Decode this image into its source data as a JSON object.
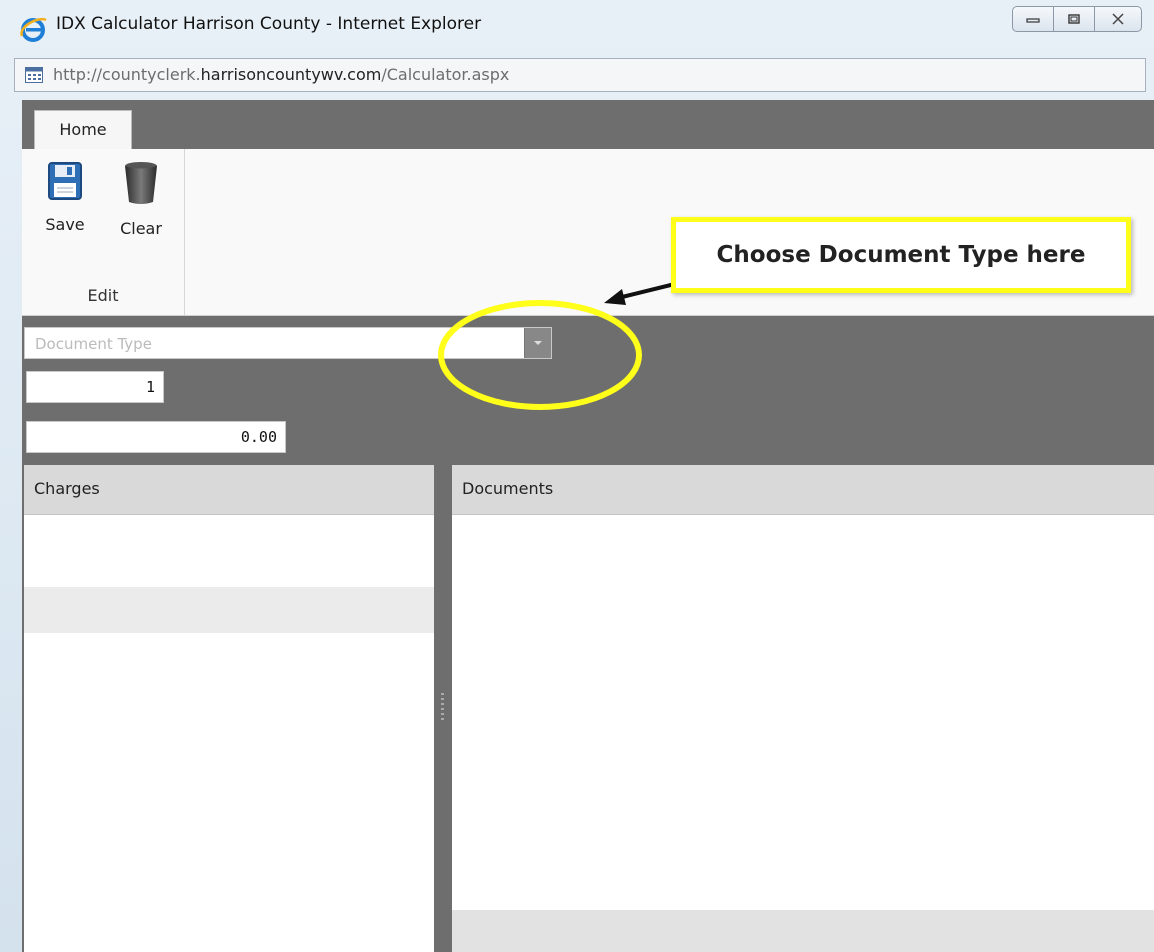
{
  "window": {
    "title": "IDX Calculator Harrison County - Internet Explorer"
  },
  "address": {
    "prefix": "http://countyclerk.",
    "domain": "harrisoncountywv.com",
    "suffix": "/Calculator.aspx"
  },
  "ribbon": {
    "tab": "Home",
    "save_label": "Save",
    "clear_label": "Clear",
    "group_label": "Edit"
  },
  "form": {
    "document_type_placeholder": "Document Type",
    "quantity": "1",
    "amount": "0.00"
  },
  "panels": {
    "charges_title": "Charges",
    "documents_title": "Documents"
  },
  "annotation": {
    "callout_text": "Choose Document Type here",
    "highlight_color": "#ffff1a"
  },
  "icons": {
    "browser": "internet-explorer-icon",
    "save": "floppy-disk-icon",
    "clear": "trash-can-icon"
  }
}
